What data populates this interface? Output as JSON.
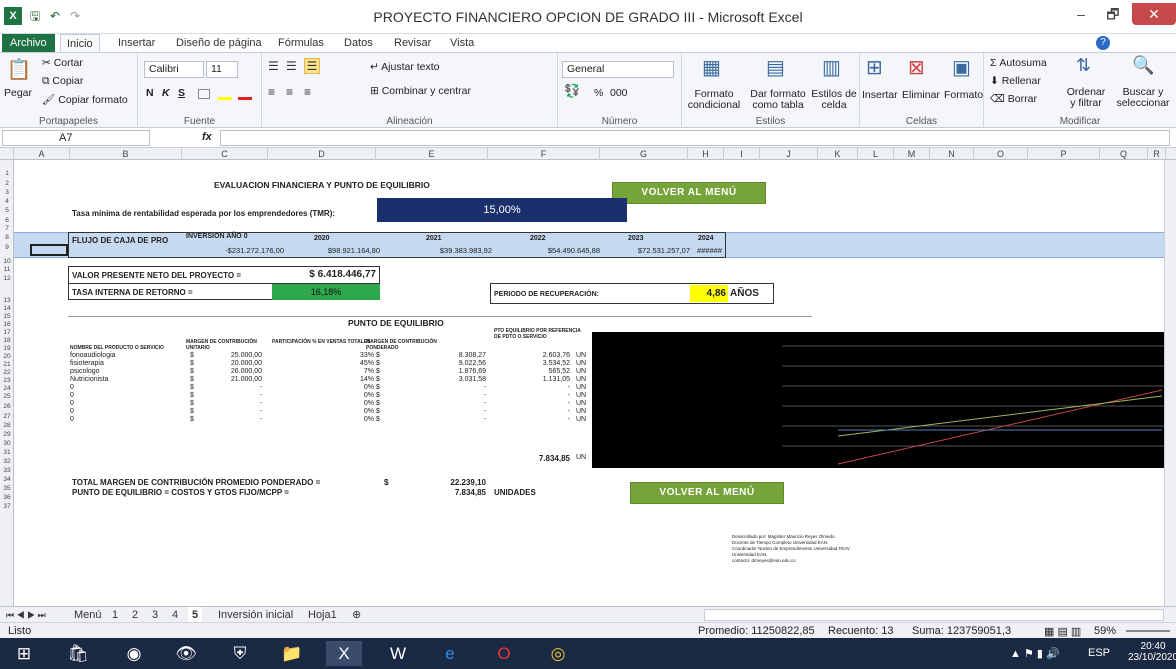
{
  "window": {
    "title": "PROYECTO FINANCIERO OPCION DE GRADO III - Microsoft Excel",
    "minimize": "–",
    "restore": "🗗",
    "close": "✕"
  },
  "quick_access": {
    "save": "🖫",
    "undo": "↶",
    "redo": "↷"
  },
  "tabs": [
    "Archivo",
    "Inicio",
    "Insertar",
    "Diseño de página",
    "Fórmulas",
    "Datos",
    "Revisar",
    "Vista"
  ],
  "ribbon": {
    "pegar": "Pegar",
    "cortar": "Cortar",
    "copiar": "Copiar",
    "copiar_formato": "Copiar formato",
    "portapapeles": "Portapapeles",
    "font_name": "Calibri",
    "font_size": "11",
    "bold": "N",
    "italic": "K",
    "underline": "S",
    "fuente": "Fuente",
    "ajustar_texto": "Ajustar texto",
    "combinar": "Combinar y centrar",
    "alineacion": "Alineación",
    "numero_format": "General",
    "pct": "%",
    "thousands": "000",
    "numero": "Número",
    "formato_condicional": "Formato condicional",
    "dar_formato_tabla": "Dar formato como tabla",
    "estilos_celda": "Estilos de celda",
    "estilos": "Estilos",
    "insertar": "Insertar",
    "eliminar": "Eliminar",
    "formato": "Formato",
    "celdas": "Celdas",
    "autosuma": "Autosuma",
    "rellenar": "Rellenar",
    "borrar": "Borrar",
    "ordenar": "Ordenar y filtrar",
    "buscar": "Buscar y seleccionar",
    "modificar": "Modificar"
  },
  "formula_bar": {
    "name_box": "A7",
    "fx": "fx",
    "value": ""
  },
  "columns": [
    "A",
    "B",
    "C",
    "D",
    "E",
    "F",
    "G",
    "H",
    "I",
    "J",
    "K",
    "L",
    "M",
    "N",
    "O",
    "P",
    "Q",
    "R"
  ],
  "rows": [
    "1",
    "2",
    "3",
    "4",
    "5",
    "6",
    "7",
    "8",
    "9",
    "10",
    "11",
    "12",
    "13",
    "14",
    "15",
    "16",
    "17",
    "18",
    "19",
    "20",
    "21",
    "22",
    "23",
    "24",
    "25",
    "26",
    "27",
    "28",
    "29",
    "30",
    "31",
    "32",
    "33",
    "34",
    "35",
    "36",
    "37"
  ],
  "sheet": {
    "title": "EVALUACION FINANCIERA Y PUNTO DE EQUILIBRIO",
    "volver1": "VOLVER AL MENÚ",
    "tmr_label": "Tasa mínima de rentabilidad esperada por los emprendedores (TMR):",
    "tmr_value": "15,00%",
    "flujo_label": "FLUJO DE CAJA DE PRO",
    "flujo_headers": [
      "INVERSION AÑO 0",
      "2020",
      "2021",
      "2022",
      "2023",
      "2024"
    ],
    "flujo_values": [
      "-$231.272.176,00",
      "$98.921.164,80",
      "$39.383.983,92",
      "$54.490.645,88",
      "$72.531.257,07",
      "######"
    ],
    "vpn_label": "VALOR PRESENTE NETO DEL PROYECTO =",
    "vpn_value": "$ 6.418.446,77",
    "tir_label": "TASA INTERNA DE RETORNO =",
    "tir_value": "16,18%",
    "periodo_label": "PERIODO DE RECUPERACIÓN:",
    "periodo_value": "4,86",
    "periodo_unit": "AÑOS",
    "pe_title": "PUNTO DE EQUILIBRIO",
    "pe_headers": [
      "NOMBRE DEL PRODUCTO O SERVICIO",
      "MARGEN DE CONTRIBUCIÓN UNITARIO",
      "PARTICIPACIÓN % EN VENTAS TOTALES",
      "MARGEN DE CONTRIBUCIÓN PONDERADO",
      "PTO EQUILIBRIO POR REFERENCIA DE PDTO O SERVICIO"
    ],
    "pe_rows": [
      {
        "name": "fonoaudiologia",
        "cur": "$",
        "margen": "25.000,00",
        "part": "33%",
        "cur2": "$",
        "pond": "8.308,27",
        "pto": "2.603,76",
        "un": "UN"
      },
      {
        "name": "fisioterapia",
        "cur": "$",
        "margen": "20.000,00",
        "part": "45%",
        "cur2": "$",
        "pond": "9.022,56",
        "pto": "3.534,52",
        "un": "UN"
      },
      {
        "name": "psicologo",
        "cur": "$",
        "margen": "26.000,00",
        "part": "7%",
        "cur2": "$",
        "pond": "1.876,69",
        "pto": "565,52",
        "un": "UN"
      },
      {
        "name": "Nutricionista",
        "cur": "$",
        "margen": "21.000,00",
        "part": "14%",
        "cur2": "$",
        "pond": "3.031,58",
        "pto": "1.131,05",
        "un": "UN"
      },
      {
        "name": "0",
        "cur": "$",
        "margen": "-",
        "part": "0%",
        "cur2": "$",
        "pond": "-",
        "pto": "-",
        "un": "UN"
      },
      {
        "name": "0",
        "cur": "$",
        "margen": "-",
        "part": "0%",
        "cur2": "$",
        "pond": "-",
        "pto": "-",
        "un": "UN"
      },
      {
        "name": "0",
        "cur": "$",
        "margen": "-",
        "part": "0%",
        "cur2": "$",
        "pond": "-",
        "pto": "-",
        "un": "UN"
      },
      {
        "name": "0",
        "cur": "$",
        "margen": "-",
        "part": "0%",
        "cur2": "$",
        "pond": "-",
        "pto": "-",
        "un": "UN"
      },
      {
        "name": "0",
        "cur": "$",
        "margen": "-",
        "part": "0%",
        "cur2": "$",
        "pond": "-",
        "pto": "-",
        "un": "UN"
      }
    ],
    "total_pto": "7.834,85",
    "total_un": "UN",
    "total_margen_label": "TOTAL MARGEN DE CONTRIBUCIÓN PROMEDIO PONDERADO =",
    "total_margen_cur": "$",
    "total_margen_value": "22.239,10",
    "pe_formula_label": "PUNTO DE EQUILIBRIO = COSTOS Y GTOS FIJO/MCPP =",
    "pe_formula_value": "7.834,85",
    "pe_formula_unit": "UNIDADES",
    "volver2": "VOLVER AL MENÚ",
    "credits": [
      "Desarrollado por: Magíster Mauricio Reyes Olmedo.",
      "Docente de Tiempo Completo Universidad EAN.",
      "Coordinador Núcleo de Emprendimiento Universidad FEAV",
      "Universidad EAN.",
      "contacto: dmreyes@ean.edu.co"
    ]
  },
  "sheet_tabs": [
    "Menú",
    "1",
    "2",
    "3",
    "4",
    "5",
    "Inversión inicial",
    "Hoja1"
  ],
  "active_sheet": "5",
  "status": {
    "mode": "Listo",
    "promedio": "Promedio: 11250822,85",
    "recuento": "Recuento: 13",
    "suma": "Suma: 123759051,3",
    "zoom": "59%"
  },
  "taskbar": {
    "lang": "ESP",
    "time": "20:40",
    "date": "23/10/2020"
  },
  "colors": {
    "excel_green": "#1f7244",
    "flujo_band": "#c5d9f1",
    "tmr_fill": "#1a2f6b",
    "tir_fill": "#2da84a",
    "periodo_fill": "#ffff00",
    "button": "#76a33a"
  }
}
